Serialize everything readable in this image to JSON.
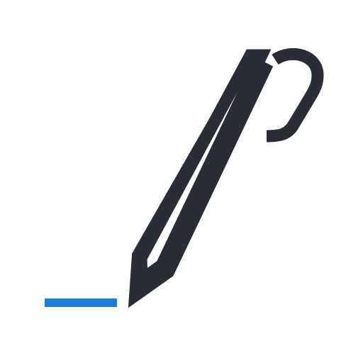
{
  "icon": {
    "name": "pen-icon",
    "pen_color": "#2b2d36",
    "underline_color": "#1c7ed6",
    "background_color": "#ffffff"
  }
}
